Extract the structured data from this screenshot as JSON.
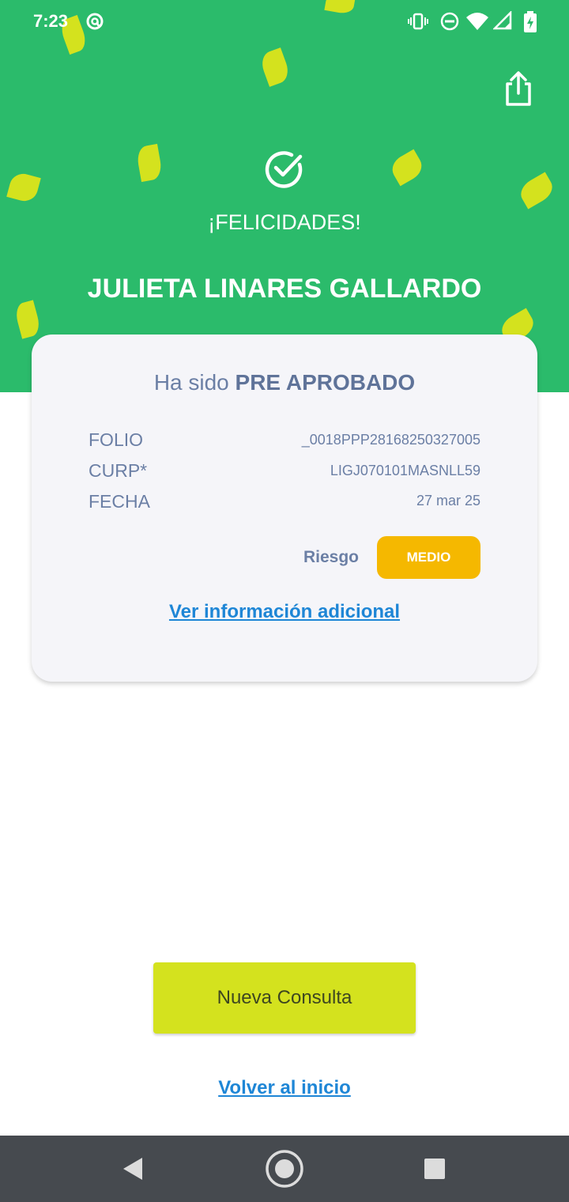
{
  "status_bar": {
    "time": "7:23",
    "icons": [
      "at-icon",
      "vibrate-icon",
      "do-not-disturb-icon",
      "wifi-icon",
      "signal-icon",
      "battery-charging-icon"
    ]
  },
  "header": {
    "share_icon": "share-icon",
    "success_icon": "check-circle-icon",
    "congrats": "¡FELICIDADES!",
    "name": "JULIETA LINARES GALLARDO"
  },
  "card": {
    "title_prefix": "Ha sido",
    "title_status": "PRE APROBADO",
    "rows": [
      {
        "label": "FOLIO",
        "value": "_0018PPP28168250327005"
      },
      {
        "label": "CURP*",
        "value": "LIGJ070101MASNLL59"
      },
      {
        "label": "FECHA",
        "value": "27 mar 25"
      }
    ],
    "risk_label": "Riesgo",
    "risk_value": "MEDIO",
    "info_link": "Ver información adicional"
  },
  "actions": {
    "new_query": "Nueva Consulta",
    "back_home": "Volver al inicio"
  },
  "colors": {
    "header_green": "#2bbb6b",
    "leaf_lime": "#d4e21e",
    "risk_badge": "#f5b800",
    "link_blue": "#1e86d6",
    "label_slate": "#6b7fa5",
    "nav_bar": "#464a4f"
  },
  "nav_bar": {
    "icons": [
      "back-icon",
      "home-icon",
      "recents-icon"
    ]
  }
}
